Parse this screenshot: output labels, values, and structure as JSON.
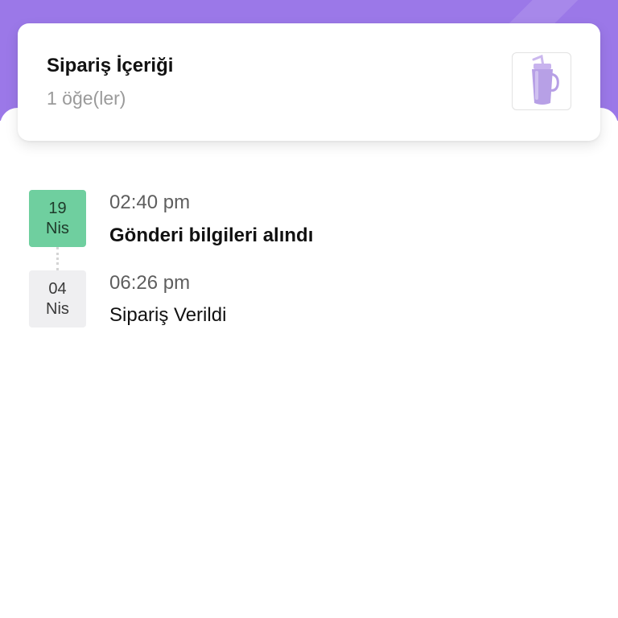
{
  "order_summary": {
    "title": "Sipariş İçeriği",
    "item_count": "1 öğe(ler)",
    "product_thumbnail": "purple-tumbler-image"
  },
  "timeline": {
    "events": [
      {
        "day": "19",
        "month": "Nis",
        "time": "02:40 pm",
        "title": "Gönderi bilgileri alındı",
        "status": "current"
      },
      {
        "day": "04",
        "month": "Nis",
        "time": "06:26 pm",
        "title": "Sipariş Verildi",
        "status": "past"
      }
    ]
  },
  "colors": {
    "header": "#9b78e8",
    "active_date": "#6fcf9f",
    "inactive_date": "#efeff1",
    "secondary_text": "#9a9a9a"
  }
}
